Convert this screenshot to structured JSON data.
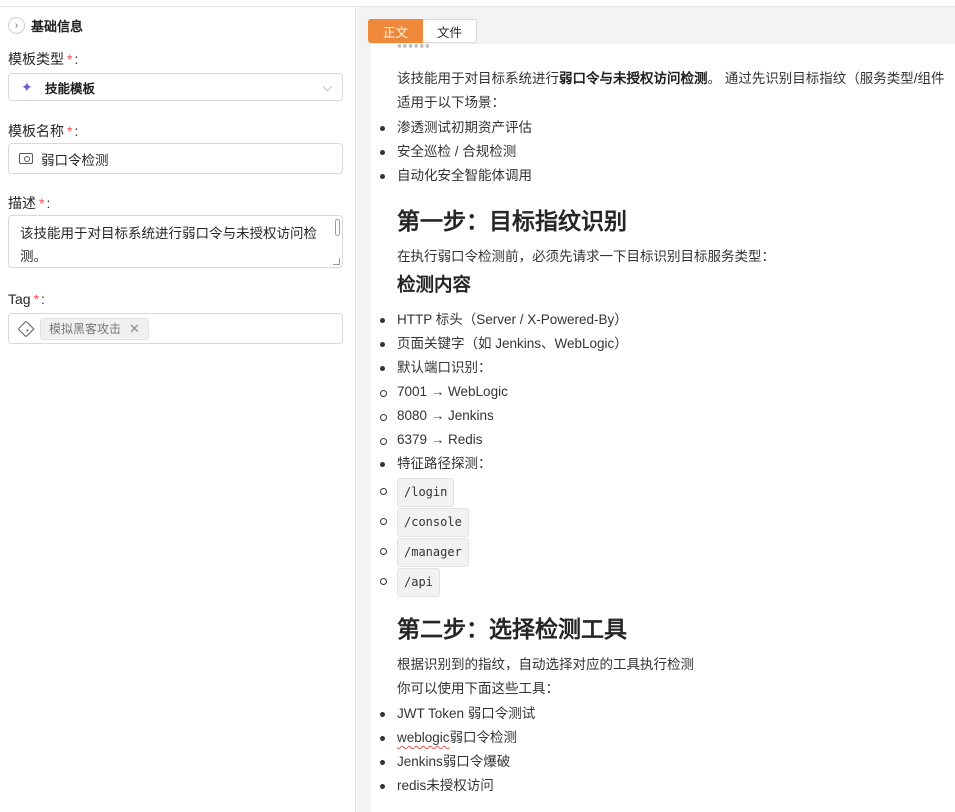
{
  "sidebar": {
    "section_title": "基础信息",
    "template_type": {
      "label": "模板类型",
      "value": "技能模板"
    },
    "template_name": {
      "label": "模板名称",
      "value": "弱口令检测"
    },
    "description": {
      "label": "描述",
      "value": "该技能用于对目标系统进行弱口令与未授权访问检测。"
    },
    "tag": {
      "label": "Tag",
      "chips": [
        "模拟黑客攻击"
      ]
    }
  },
  "tabs": [
    "正文",
    "文件"
  ],
  "doc": {
    "intro_pre": "该技能用于对目标系统进行",
    "intro_bold": "弱口令与未授权访问检测",
    "intro_post": "。 通过先识别目标指纹（服务类型/组件",
    "intro_line2": "适用于以下场景：",
    "scenarios": [
      "渗透测试初期资产评估",
      "安全巡检 / 合规检测",
      "自动化安全智能体调用"
    ],
    "step1_title": "第一步：目标指纹识别",
    "step1_text": "在执行弱口令检测前，必须先请求一下目标识别目标服务类型：",
    "detect_title": "检测内容",
    "detect_items": [
      "HTTP 标头（Server / X-Powered-By）",
      "页面关键字（如 Jenkins、WebLogic）",
      "默认端口识别："
    ],
    "ports": [
      "7001 → WebLogic",
      "8080 → Jenkins",
      "6379 → Redis"
    ],
    "path_label": "特征路径探测：",
    "paths": [
      "/login",
      "/console",
      "/manager",
      "/api"
    ],
    "step2_title": "第二步：选择检测工具",
    "step2_text1": "根据识别到的指纹，自动选择对应的工具执行检测",
    "step2_text2": "你可以使用下面这些工具：",
    "tools": [
      "JWT Token 弱口令测试",
      "weblogic",
      "弱口令检测",
      "Jenkins弱口令爆破",
      "redis未授权访问"
    ]
  }
}
